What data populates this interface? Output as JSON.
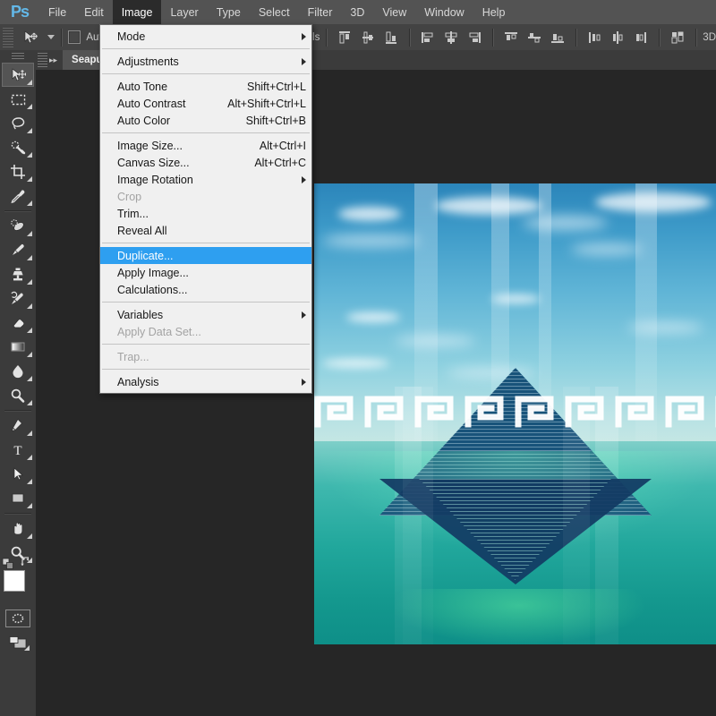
{
  "app": {
    "name": "Adobe Photoshop",
    "logo_text": "Ps"
  },
  "menubar": {
    "items": [
      {
        "label": "File",
        "active": false
      },
      {
        "label": "Edit",
        "active": false
      },
      {
        "label": "Image",
        "active": true
      },
      {
        "label": "Layer",
        "active": false
      },
      {
        "label": "Type",
        "active": false
      },
      {
        "label": "Select",
        "active": false
      },
      {
        "label": "Filter",
        "active": false
      },
      {
        "label": "3D",
        "active": false
      },
      {
        "label": "View",
        "active": false
      },
      {
        "label": "Window",
        "active": false
      },
      {
        "label": "Help",
        "active": false
      }
    ]
  },
  "options_bar": {
    "tool_icon": "move-tool-icon",
    "auto_select_label": "Auto-",
    "auto_select_checked": false,
    "controls_label": "rols",
    "right_label": "3D",
    "align_icons": [
      "align-top-edges-icon",
      "align-vertical-centers-icon",
      "align-bottom-edges-icon",
      "align-left-edges-icon",
      "align-horizontal-centers-icon",
      "align-right-edges-icon",
      "distribute-top-edges-icon",
      "distribute-vertical-centers-icon",
      "distribute-bottom-edges-icon",
      "distribute-left-edges-icon",
      "distribute-horizontal-centers-icon",
      "distribute-right-edges-icon",
      "auto-align-layers-icon"
    ]
  },
  "document_tabs": [
    {
      "title": "Seapunk.jpg",
      "active": true
    }
  ],
  "image_menu": {
    "title": "Image",
    "highlight_color": "#2e9ff0",
    "background_color": "#f0f0f0",
    "groups": [
      {
        "items": [
          {
            "label": "Mode",
            "shortcut": "",
            "submenu": true,
            "disabled": false,
            "selected": false
          }
        ]
      },
      {
        "items": [
          {
            "label": "Adjustments",
            "shortcut": "",
            "submenu": true,
            "disabled": false,
            "selected": false
          }
        ]
      },
      {
        "items": [
          {
            "label": "Auto Tone",
            "shortcut": "Shift+Ctrl+L",
            "submenu": false,
            "disabled": false,
            "selected": false
          },
          {
            "label": "Auto Contrast",
            "shortcut": "Alt+Shift+Ctrl+L",
            "submenu": false,
            "disabled": false,
            "selected": false
          },
          {
            "label": "Auto Color",
            "shortcut": "Shift+Ctrl+B",
            "submenu": false,
            "disabled": false,
            "selected": false
          }
        ]
      },
      {
        "items": [
          {
            "label": "Image Size...",
            "shortcut": "Alt+Ctrl+I",
            "submenu": false,
            "disabled": false,
            "selected": false
          },
          {
            "label": "Canvas Size...",
            "shortcut": "Alt+Ctrl+C",
            "submenu": false,
            "disabled": false,
            "selected": false
          },
          {
            "label": "Image Rotation",
            "shortcut": "",
            "submenu": true,
            "disabled": false,
            "selected": false
          },
          {
            "label": "Crop",
            "shortcut": "",
            "submenu": false,
            "disabled": true,
            "selected": false
          },
          {
            "label": "Trim...",
            "shortcut": "",
            "submenu": false,
            "disabled": false,
            "selected": false
          },
          {
            "label": "Reveal All",
            "shortcut": "",
            "submenu": false,
            "disabled": false,
            "selected": false
          }
        ]
      },
      {
        "items": [
          {
            "label": "Duplicate...",
            "shortcut": "",
            "submenu": false,
            "disabled": false,
            "selected": true
          },
          {
            "label": "Apply Image...",
            "shortcut": "",
            "submenu": false,
            "disabled": false,
            "selected": false
          },
          {
            "label": "Calculations...",
            "shortcut": "",
            "submenu": false,
            "disabled": false,
            "selected": false
          }
        ]
      },
      {
        "items": [
          {
            "label": "Variables",
            "shortcut": "",
            "submenu": true,
            "disabled": false,
            "selected": false
          },
          {
            "label": "Apply Data Set...",
            "shortcut": "",
            "submenu": false,
            "disabled": true,
            "selected": false
          }
        ]
      },
      {
        "items": [
          {
            "label": "Trap...",
            "shortcut": "",
            "submenu": false,
            "disabled": true,
            "selected": false
          }
        ]
      },
      {
        "items": [
          {
            "label": "Analysis",
            "shortcut": "",
            "submenu": true,
            "disabled": false,
            "selected": false
          }
        ]
      }
    ]
  },
  "toolbar": {
    "tools": [
      {
        "name": "move-tool",
        "selected": true,
        "group_end": false
      },
      {
        "name": "rectangular-marquee-tool",
        "selected": false,
        "group_end": false
      },
      {
        "name": "lasso-tool",
        "selected": false,
        "group_end": false
      },
      {
        "name": "quick-selection-tool",
        "selected": false,
        "group_end": false
      },
      {
        "name": "crop-tool",
        "selected": false,
        "group_end": false
      },
      {
        "name": "eyedropper-tool",
        "selected": false,
        "group_end": true
      },
      {
        "name": "spot-healing-brush-tool",
        "selected": false,
        "group_end": false
      },
      {
        "name": "brush-tool",
        "selected": false,
        "group_end": false
      },
      {
        "name": "clone-stamp-tool",
        "selected": false,
        "group_end": false
      },
      {
        "name": "history-brush-tool",
        "selected": false,
        "group_end": false
      },
      {
        "name": "eraser-tool",
        "selected": false,
        "group_end": false
      },
      {
        "name": "gradient-tool",
        "selected": false,
        "group_end": false
      },
      {
        "name": "blur-tool",
        "selected": false,
        "group_end": false
      },
      {
        "name": "dodge-tool",
        "selected": false,
        "group_end": true
      },
      {
        "name": "pen-tool",
        "selected": false,
        "group_end": false
      },
      {
        "name": "type-tool",
        "selected": false,
        "group_end": false
      },
      {
        "name": "path-selection-tool",
        "selected": false,
        "group_end": false
      },
      {
        "name": "rectangle-tool",
        "selected": false,
        "group_end": true
      },
      {
        "name": "hand-tool",
        "selected": false,
        "group_end": false
      },
      {
        "name": "zoom-tool",
        "selected": false,
        "group_end": false
      }
    ],
    "foreground_color": "#ffffff",
    "background_color": "#eeeeee",
    "quick_mask_label": "quick-mask-mode",
    "screen_mode_label": "change-screen-mode"
  },
  "canvas": {
    "document_name": "Seapunk.jpg",
    "artwork_description": "Seapunk collage: mirrored pyramid over turquoise ocean with Greek key meander band",
    "background_color": "#262626",
    "palette": {
      "sky_top": "#2b85ba",
      "sky_bottom": "#c9e8e3",
      "sea_top": "#3fb8ae",
      "sea_bottom": "#0e8f88",
      "pyramid": "#1f5f86",
      "meander": "#ffffff"
    },
    "meander_repeat": 8,
    "column_count": 6
  }
}
